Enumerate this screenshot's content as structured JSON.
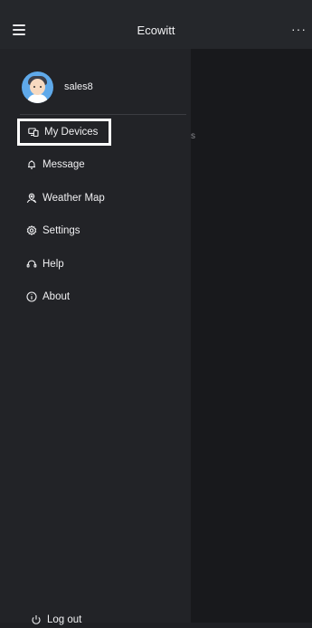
{
  "header": {
    "title": "Ecowitt",
    "menu_icon": "hamburger-menu-icon",
    "more_label": "···"
  },
  "background_page": {
    "peek_text": "s"
  },
  "drawer": {
    "user": {
      "avatar": "user-avatar",
      "name": "sales8"
    },
    "items": [
      {
        "label": "My Devices",
        "icon": "devices-icon",
        "selected": true
      },
      {
        "label": "Message",
        "icon": "bell-icon",
        "selected": false
      },
      {
        "label": "Weather Map",
        "icon": "map-pin-icon",
        "selected": false
      },
      {
        "label": "Settings",
        "icon": "gear-icon",
        "selected": false
      },
      {
        "label": "Help",
        "icon": "help-icon",
        "selected": false
      },
      {
        "label": "About",
        "icon": "info-icon",
        "selected": false
      }
    ],
    "logout": {
      "label": "Log out",
      "icon": "power-icon"
    }
  },
  "colors": {
    "topbar": "#25272b",
    "drawer": "#222327",
    "main_dim": "#18191c",
    "text": "#f0f0f2",
    "avatar_bg": "#5fa9ea",
    "highlight_border": "#ffffff"
  }
}
